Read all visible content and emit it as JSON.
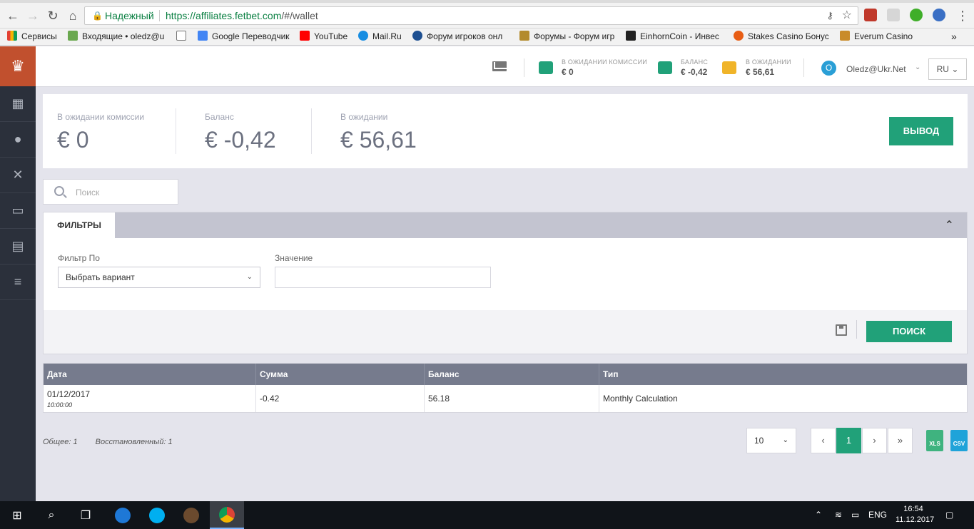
{
  "browser": {
    "secure_label": "Надежный",
    "url_host": "https://affiliates.fetbet.com",
    "url_rest": "/#/wallet"
  },
  "bookmarks": [
    {
      "label": "Сервисы",
      "color": "#e34133"
    },
    {
      "label": "Входящие • oledz@u",
      "color": "#6aa84f"
    },
    {
      "label": "",
      "color": "#ffffff"
    },
    {
      "label": "Google Переводчик",
      "color": "#4285f4"
    },
    {
      "label": "YouTube",
      "color": "#ff0000"
    },
    {
      "label": "Mail.Ru",
      "color": "#168de2"
    },
    {
      "label": "Форум игроков онл",
      "color": "#1d4f91"
    },
    {
      "label": "Форумы - Форум игр",
      "color": "#b38b2d"
    },
    {
      "label": "EinhornCoin - Инвес",
      "color": "#222222"
    },
    {
      "label": "Stakes Casino Бонус",
      "color": "#e85d14"
    },
    {
      "label": "Everum Casino",
      "color": "#c98b2a"
    }
  ],
  "bookmarks_more": "»",
  "topbar": {
    "wallets": [
      {
        "label": "В ОЖИДАНИИ КОМИССИИ",
        "value": "€ 0",
        "color": "#21a179"
      },
      {
        "label": "БАЛАНС",
        "value": "€ -0,42",
        "color": "#21a179"
      },
      {
        "label": "В ОЖИДАНИИ",
        "value": "€ 56,61",
        "color": "#f0b429"
      }
    ],
    "avatar_letter": "O",
    "user": "Oledz@Ukr.Net",
    "lang": "RU"
  },
  "summary": {
    "items": [
      {
        "label": "В ожидании комиссии",
        "value": "€ 0"
      },
      {
        "label": "Баланс",
        "value": "€ -0,42"
      },
      {
        "label": "В ожидании",
        "value": "€ 56,61"
      }
    ],
    "withdraw_label": "ВЫВОД"
  },
  "search": {
    "placeholder": "Поиск"
  },
  "filters": {
    "tab_label": "ФИЛЬТРЫ",
    "filter_by_label": "Фильтр По",
    "filter_by_value": "Выбрать вариант",
    "value_label": "Значение",
    "search_button": "ПОИСК"
  },
  "table": {
    "headers": [
      "Дата",
      "Сумма",
      "Баланс",
      "Тип"
    ],
    "rows": [
      {
        "date": "01/12/2017",
        "time": "10:00:00",
        "amount": "-0.42",
        "balance": "56.18",
        "type": "Monthly Calculation"
      }
    ]
  },
  "totals": {
    "total": "Общее: 1",
    "restored": "Восстановленный: 1"
  },
  "pager": {
    "page_size": "10",
    "prev": "‹",
    "current": "1",
    "next": "›",
    "last": "»"
  },
  "exports": {
    "xls": "XLS",
    "csv": "CSV"
  },
  "taskbar": {
    "lang": "ENG",
    "time": "16:54",
    "date": "11.12.2017"
  }
}
